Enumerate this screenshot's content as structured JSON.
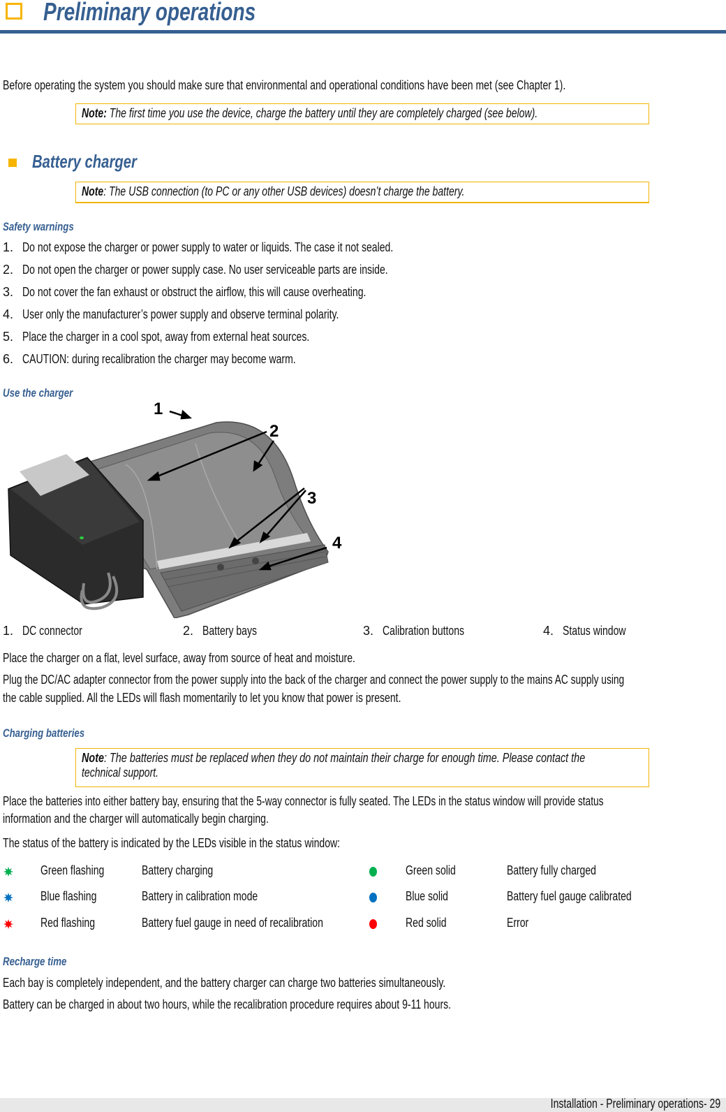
{
  "header": {
    "title": "Preliminary operations"
  },
  "intro": "Before operating the system you should make sure that environmental and operational conditions have been met (see Chapter 1).",
  "note1": {
    "label": "Note:",
    "text": " The first time you use the device, charge the battery until they are completely charged (see below)."
  },
  "section": {
    "title": "Battery charger"
  },
  "note2": {
    "label": "Note",
    "text": ": The USB connection (to PC or any other USB devices) doesn’t charge the battery."
  },
  "safety": {
    "heading": "Safety warnings",
    "items": [
      {
        "num": "1.",
        "text": "Do not expose the charger or power supply to water or liquids. The case it not sealed."
      },
      {
        "num": "2.",
        "text": "Do not open the charger or power supply case. No user serviceable parts are inside."
      },
      {
        "num": "3.",
        "text": "Do not cover the fan exhaust or obstruct the airflow, this will cause overheating."
      },
      {
        "num": "4.",
        "text": "User only the manufacturer’s power supply and observe terminal polarity."
      },
      {
        "num": "5.",
        "text": "Place the charger in a cool spot, away from external heat sources."
      },
      {
        "num": "6.",
        "text": "CAUTION: during recalibration the charger may become warm."
      }
    ]
  },
  "use": {
    "heading": "Use the charger",
    "callouts": [
      "1",
      "2",
      "3",
      "4"
    ],
    "legend": [
      {
        "num": "1.",
        "label": "DC connector"
      },
      {
        "num": "2.",
        "label": "Battery bays"
      },
      {
        "num": "3.",
        "label": "Calibration buttons"
      },
      {
        "num": "4.",
        "label": "Status window"
      }
    ],
    "para1": "Place the charger on a flat, level surface, away from source of heat and moisture.",
    "para2a": "Plug the DC/AC adapter connector from the power supply into the back of the charger and connect the power supply to the mains AC supply using",
    "para2b": "the cable supplied. All the LEDs will flash momentarily to let you know that power is present."
  },
  "charging": {
    "heading": "Charging batteries",
    "note_label": "Note",
    "note_line1": ": The batteries must be replaced when they do not maintain their charge for enough time. Please contact the",
    "note_line2": "technical support.",
    "para1a": "Place the batteries into either battery bay, ensuring that the 5-way connector is fully seated. The LEDs in the status window will provide status",
    "para1b": "information and the charger will automatically begin charging.",
    "para2": "The status of the battery is indicated by the LEDs visible in the status window:",
    "statuses": [
      {
        "flash_color": "#00b050",
        "flash_label": "Green flashing",
        "flash_meaning": "Battery charging",
        "solid_color": "#00b050",
        "solid_label": "Green solid",
        "solid_meaning": "Battery fully charged"
      },
      {
        "flash_color": "#0070c0",
        "flash_label": "Blue flashing",
        "flash_meaning": "Battery in calibration mode",
        "solid_color": "#0070c0",
        "solid_label": "Blue solid",
        "solid_meaning": "Battery fuel gauge calibrated"
      },
      {
        "flash_color": "#ff0000",
        "flash_label": "Red flashing",
        "flash_meaning": "Battery fuel gauge in need of recalibration",
        "solid_color": "#ff0000",
        "solid_label": "Red solid",
        "solid_meaning": "Error"
      }
    ]
  },
  "recharge": {
    "heading": "Recharge time",
    "para1": "Each bay is completely independent, and the battery charger can charge two batteries simultaneously.",
    "para2": "Battery can be charged in about two hours, while the recalibration procedure requires about 9-11 hours."
  },
  "footer": {
    "text": "Installation - Preliminary operations- 29"
  }
}
